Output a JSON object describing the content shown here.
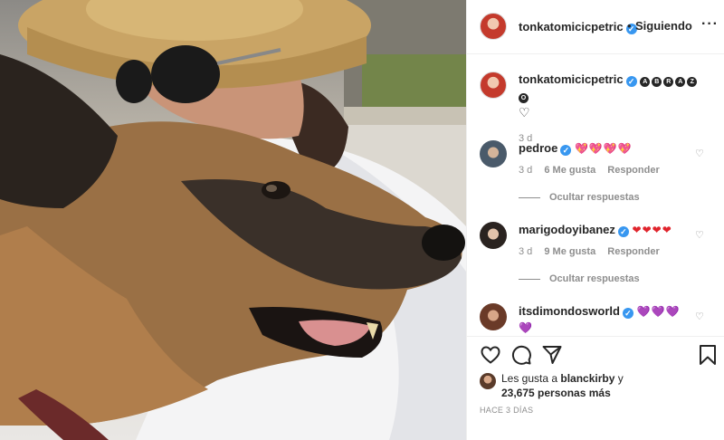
{
  "post": {
    "username": "tonkatomicicpetric",
    "follow_separator": "•",
    "follow_status": "Siguiendo",
    "more_icon": "more-horizontal-icon"
  },
  "caption": {
    "username": "tonkatomicicpetric",
    "letters": [
      "A",
      "B",
      "R",
      "A",
      "Z",
      "O"
    ],
    "heart": "♡",
    "age": "3 d"
  },
  "comments": [
    {
      "username": "pedroe",
      "emojis": "💖💖💖💖",
      "age": "3 d",
      "likes": "6 Me gusta",
      "reply": "Responder",
      "hide_replies": "Ocultar respuestas"
    },
    {
      "username": "marigodoyibanez",
      "emojis": "❤❤❤❤",
      "age": "3 d",
      "likes": "9 Me gusta",
      "reply": "Responder",
      "hide_replies": "Ocultar respuestas"
    },
    {
      "username": "itsdimondosworld",
      "emojis": "💜💜💜",
      "emojis_line2": "💜"
    }
  ],
  "actions": {
    "like_icon": "heart-icon",
    "comment_icon": "comment-icon",
    "share_icon": "share-icon",
    "save_icon": "bookmark-icon"
  },
  "likes": {
    "prefix": "Les gusta a",
    "liked_by": "blanckirby",
    "suffix": "y",
    "count_text": "23,675 personas más"
  },
  "timestamp": "HACE 3 DÍAS",
  "colors": {
    "verified": "#3897f0",
    "text": "#262626",
    "muted": "#8e8e8e",
    "border": "#efefef"
  }
}
